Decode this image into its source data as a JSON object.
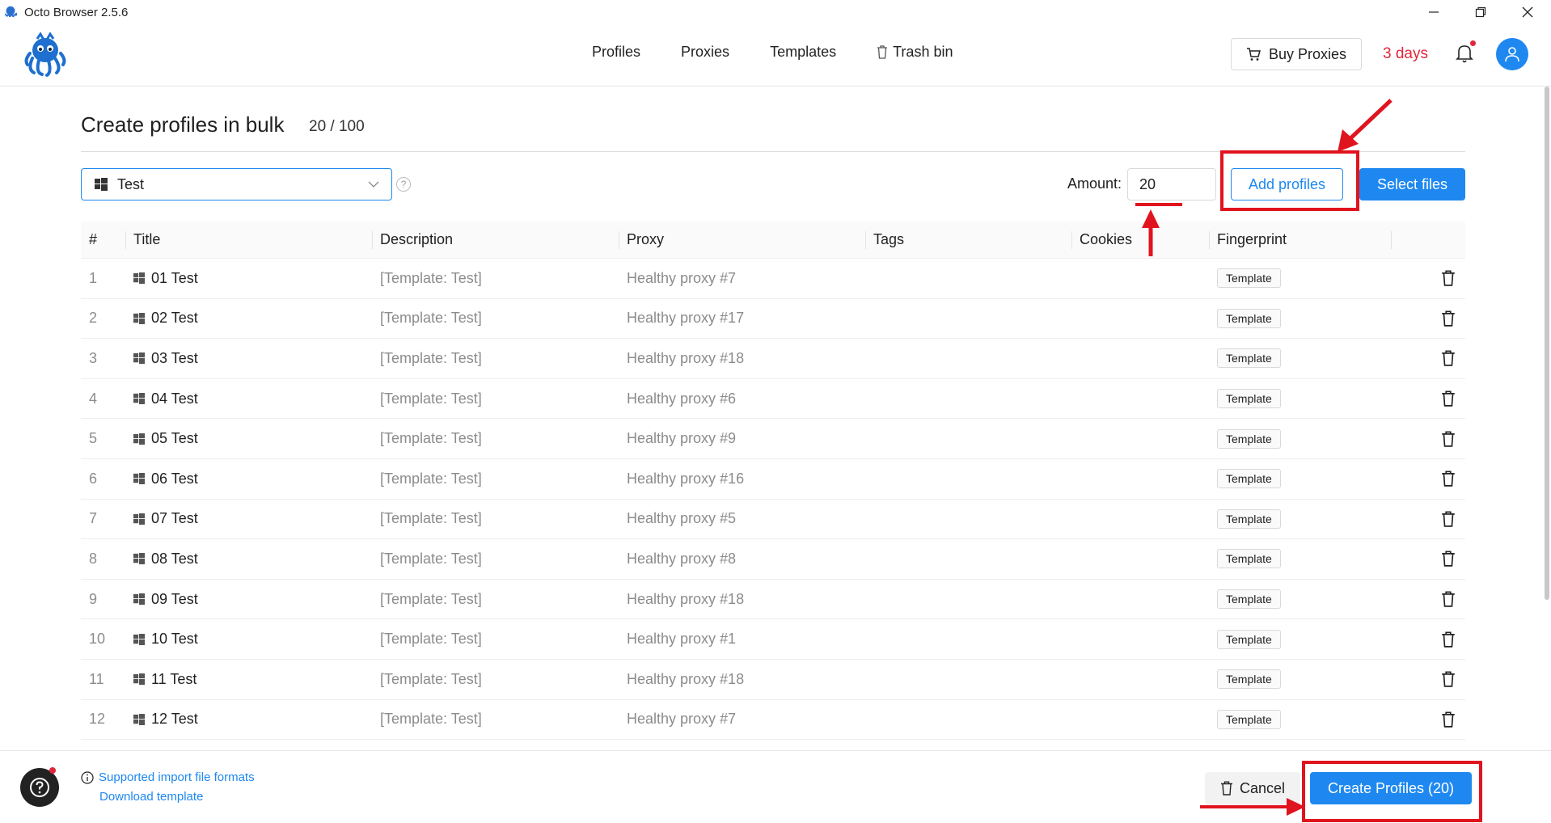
{
  "window": {
    "title": "Octo Browser 2.5.6",
    "controls": [
      "minimize",
      "restore",
      "close"
    ]
  },
  "header": {
    "nav": [
      {
        "label": "Profiles"
      },
      {
        "label": "Proxies"
      },
      {
        "label": "Templates"
      },
      {
        "label": "Trash bin",
        "icon": "trash-icon"
      }
    ],
    "buy_proxies_label": "Buy Proxies",
    "days_left": "3 days",
    "notifications_unread": true
  },
  "page": {
    "title": "Create profiles in bulk",
    "count": "20 / 100",
    "template_select": {
      "value": "Test",
      "icon": "windows-icon"
    },
    "amount_label": "Amount:",
    "amount_value": "20",
    "add_profiles_label": "Add profiles",
    "select_files_label": "Select files"
  },
  "table": {
    "columns": [
      "#",
      "Title",
      "Description",
      "Proxy",
      "Tags",
      "Cookies",
      "Fingerprint",
      ""
    ],
    "rows": [
      {
        "num": "1",
        "title": "01 Test",
        "description": "[Template: Test]",
        "proxy": "Healthy proxy #7",
        "tags": "",
        "cookies": "",
        "fingerprint": "Template"
      },
      {
        "num": "2",
        "title": "02 Test",
        "description": "[Template: Test]",
        "proxy": "Healthy proxy #17",
        "tags": "",
        "cookies": "",
        "fingerprint": "Template"
      },
      {
        "num": "3",
        "title": "03 Test",
        "description": "[Template: Test]",
        "proxy": "Healthy proxy #18",
        "tags": "",
        "cookies": "",
        "fingerprint": "Template"
      },
      {
        "num": "4",
        "title": "04 Test",
        "description": "[Template: Test]",
        "proxy": "Healthy proxy #6",
        "tags": "",
        "cookies": "",
        "fingerprint": "Template"
      },
      {
        "num": "5",
        "title": "05 Test",
        "description": "[Template: Test]",
        "proxy": "Healthy proxy #9",
        "tags": "",
        "cookies": "",
        "fingerprint": "Template"
      },
      {
        "num": "6",
        "title": "06 Test",
        "description": "[Template: Test]",
        "proxy": "Healthy proxy #16",
        "tags": "",
        "cookies": "",
        "fingerprint": "Template"
      },
      {
        "num": "7",
        "title": "07 Test",
        "description": "[Template: Test]",
        "proxy": "Healthy proxy #5",
        "tags": "",
        "cookies": "",
        "fingerprint": "Template"
      },
      {
        "num": "8",
        "title": "08 Test",
        "description": "[Template: Test]",
        "proxy": "Healthy proxy #8",
        "tags": "",
        "cookies": "",
        "fingerprint": "Template"
      },
      {
        "num": "9",
        "title": "09 Test",
        "description": "[Template: Test]",
        "proxy": "Healthy proxy #18",
        "tags": "",
        "cookies": "",
        "fingerprint": "Template"
      },
      {
        "num": "10",
        "title": "10 Test",
        "description": "[Template: Test]",
        "proxy": "Healthy proxy #1",
        "tags": "",
        "cookies": "",
        "fingerprint": "Template"
      },
      {
        "num": "11",
        "title": "11 Test",
        "description": "[Template: Test]",
        "proxy": "Healthy proxy #18",
        "tags": "",
        "cookies": "",
        "fingerprint": "Template"
      },
      {
        "num": "12",
        "title": "12 Test",
        "description": "[Template: Test]",
        "proxy": "Healthy proxy #7",
        "tags": "",
        "cookies": "",
        "fingerprint": "Template"
      }
    ]
  },
  "footer": {
    "supported_formats_label": "Supported import file formats",
    "download_template_label": "Download template",
    "cancel_label": "Cancel",
    "create_label": "Create Profiles (20)"
  },
  "colors": {
    "accent": "#1e88f0",
    "alert": "#e0263a",
    "annotation": "#e0141e"
  }
}
